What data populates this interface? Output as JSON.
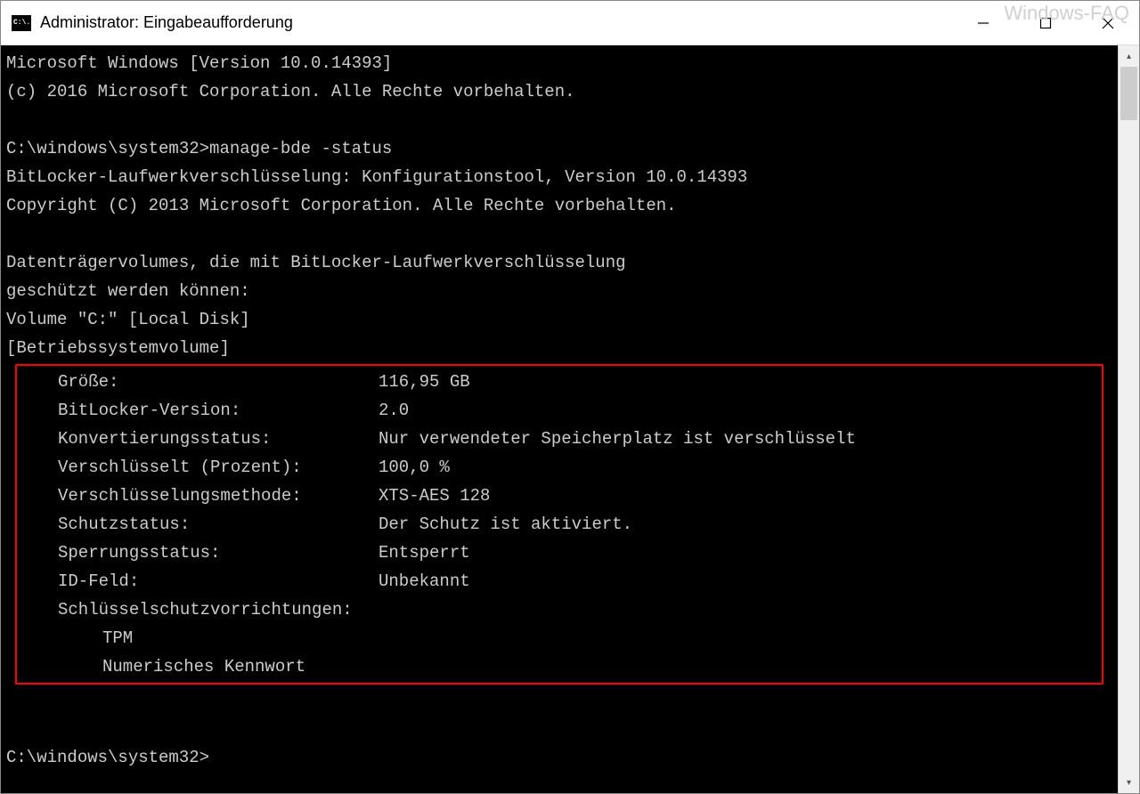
{
  "watermark": "Windows-FAQ",
  "window": {
    "title": "Administrator: Eingabeaufforderung"
  },
  "console": {
    "line1": "Microsoft Windows [Version 10.0.14393]",
    "line2": "(c) 2016 Microsoft Corporation. Alle Rechte vorbehalten.",
    "prompt1_path": "C:\\windows\\system32>",
    "prompt1_cmd": "manage-bde -status",
    "tool_line1": "BitLocker-Laufwerkverschlüsselung: Konfigurationstool, Version 10.0.14393",
    "tool_line2": "Copyright (C) 2013 Microsoft Corporation. Alle Rechte vorbehalten.",
    "vol_line1": "Datenträgervolumes, die mit BitLocker-Laufwerkverschlüsselung",
    "vol_line2": "geschützt werden können:",
    "vol_line3": "Volume \"C:\" [Local Disk]",
    "vol_line4": "[Betriebssystemvolume]",
    "details": [
      {
        "label": "Größe:",
        "value": "116,95 GB"
      },
      {
        "label": "BitLocker-Version:",
        "value": "2.0"
      },
      {
        "label": "Konvertierungsstatus:",
        "value": "Nur verwendeter Speicherplatz ist verschlüsselt"
      },
      {
        "label": "Verschlüsselt (Prozent):",
        "value": "100,0 %"
      },
      {
        "label": "Verschlüsselungsmethode:",
        "value": "XTS-AES 128"
      },
      {
        "label": "Schutzstatus:",
        "value": "Der Schutz ist aktiviert."
      },
      {
        "label": "Sperrungsstatus:",
        "value": "Entsperrt"
      },
      {
        "label": "ID-Feld:",
        "value": "Unbekannt"
      }
    ],
    "protectors_label": "Schlüsselschutzvorrichtungen:",
    "protectors": [
      "TPM",
      "Numerisches Kennwort"
    ],
    "prompt2": "C:\\windows\\system32>"
  }
}
